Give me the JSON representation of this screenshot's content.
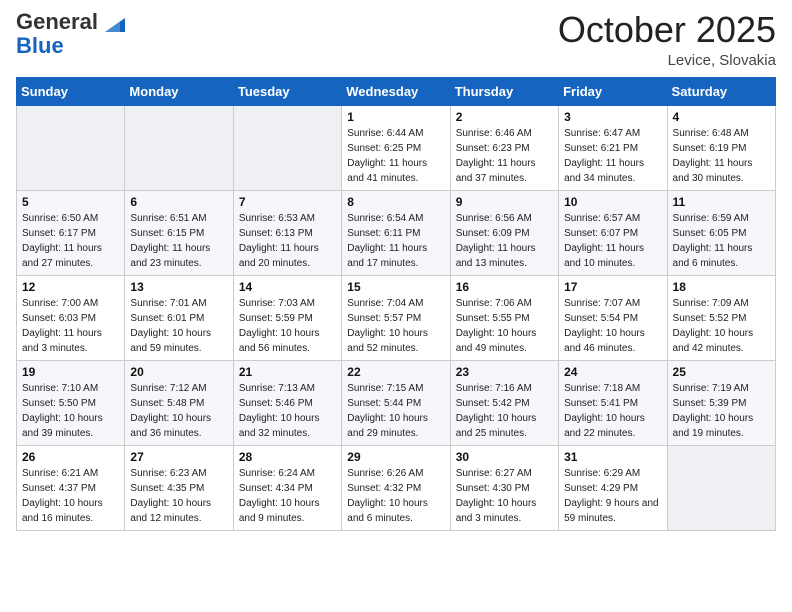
{
  "header": {
    "logo_general": "General",
    "logo_blue": "Blue",
    "month": "October 2025",
    "location": "Levice, Slovakia"
  },
  "weekdays": [
    "Sunday",
    "Monday",
    "Tuesday",
    "Wednesday",
    "Thursday",
    "Friday",
    "Saturday"
  ],
  "rows": [
    [
      {
        "day": "",
        "sunrise": "",
        "sunset": "",
        "daylight": "",
        "empty": true
      },
      {
        "day": "",
        "sunrise": "",
        "sunset": "",
        "daylight": "",
        "empty": true
      },
      {
        "day": "",
        "sunrise": "",
        "sunset": "",
        "daylight": "",
        "empty": true
      },
      {
        "day": "1",
        "sunrise": "Sunrise: 6:44 AM",
        "sunset": "Sunset: 6:25 PM",
        "daylight": "Daylight: 11 hours and 41 minutes."
      },
      {
        "day": "2",
        "sunrise": "Sunrise: 6:46 AM",
        "sunset": "Sunset: 6:23 PM",
        "daylight": "Daylight: 11 hours and 37 minutes."
      },
      {
        "day": "3",
        "sunrise": "Sunrise: 6:47 AM",
        "sunset": "Sunset: 6:21 PM",
        "daylight": "Daylight: 11 hours and 34 minutes."
      },
      {
        "day": "4",
        "sunrise": "Sunrise: 6:48 AM",
        "sunset": "Sunset: 6:19 PM",
        "daylight": "Daylight: 11 hours and 30 minutes."
      }
    ],
    [
      {
        "day": "5",
        "sunrise": "Sunrise: 6:50 AM",
        "sunset": "Sunset: 6:17 PM",
        "daylight": "Daylight: 11 hours and 27 minutes."
      },
      {
        "day": "6",
        "sunrise": "Sunrise: 6:51 AM",
        "sunset": "Sunset: 6:15 PM",
        "daylight": "Daylight: 11 hours and 23 minutes."
      },
      {
        "day": "7",
        "sunrise": "Sunrise: 6:53 AM",
        "sunset": "Sunset: 6:13 PM",
        "daylight": "Daylight: 11 hours and 20 minutes."
      },
      {
        "day": "8",
        "sunrise": "Sunrise: 6:54 AM",
        "sunset": "Sunset: 6:11 PM",
        "daylight": "Daylight: 11 hours and 17 minutes."
      },
      {
        "day": "9",
        "sunrise": "Sunrise: 6:56 AM",
        "sunset": "Sunset: 6:09 PM",
        "daylight": "Daylight: 11 hours and 13 minutes."
      },
      {
        "day": "10",
        "sunrise": "Sunrise: 6:57 AM",
        "sunset": "Sunset: 6:07 PM",
        "daylight": "Daylight: 11 hours and 10 minutes."
      },
      {
        "day": "11",
        "sunrise": "Sunrise: 6:59 AM",
        "sunset": "Sunset: 6:05 PM",
        "daylight": "Daylight: 11 hours and 6 minutes."
      }
    ],
    [
      {
        "day": "12",
        "sunrise": "Sunrise: 7:00 AM",
        "sunset": "Sunset: 6:03 PM",
        "daylight": "Daylight: 11 hours and 3 minutes."
      },
      {
        "day": "13",
        "sunrise": "Sunrise: 7:01 AM",
        "sunset": "Sunset: 6:01 PM",
        "daylight": "Daylight: 10 hours and 59 minutes."
      },
      {
        "day": "14",
        "sunrise": "Sunrise: 7:03 AM",
        "sunset": "Sunset: 5:59 PM",
        "daylight": "Daylight: 10 hours and 56 minutes."
      },
      {
        "day": "15",
        "sunrise": "Sunrise: 7:04 AM",
        "sunset": "Sunset: 5:57 PM",
        "daylight": "Daylight: 10 hours and 52 minutes."
      },
      {
        "day": "16",
        "sunrise": "Sunrise: 7:06 AM",
        "sunset": "Sunset: 5:55 PM",
        "daylight": "Daylight: 10 hours and 49 minutes."
      },
      {
        "day": "17",
        "sunrise": "Sunrise: 7:07 AM",
        "sunset": "Sunset: 5:54 PM",
        "daylight": "Daylight: 10 hours and 46 minutes."
      },
      {
        "day": "18",
        "sunrise": "Sunrise: 7:09 AM",
        "sunset": "Sunset: 5:52 PM",
        "daylight": "Daylight: 10 hours and 42 minutes."
      }
    ],
    [
      {
        "day": "19",
        "sunrise": "Sunrise: 7:10 AM",
        "sunset": "Sunset: 5:50 PM",
        "daylight": "Daylight: 10 hours and 39 minutes."
      },
      {
        "day": "20",
        "sunrise": "Sunrise: 7:12 AM",
        "sunset": "Sunset: 5:48 PM",
        "daylight": "Daylight: 10 hours and 36 minutes."
      },
      {
        "day": "21",
        "sunrise": "Sunrise: 7:13 AM",
        "sunset": "Sunset: 5:46 PM",
        "daylight": "Daylight: 10 hours and 32 minutes."
      },
      {
        "day": "22",
        "sunrise": "Sunrise: 7:15 AM",
        "sunset": "Sunset: 5:44 PM",
        "daylight": "Daylight: 10 hours and 29 minutes."
      },
      {
        "day": "23",
        "sunrise": "Sunrise: 7:16 AM",
        "sunset": "Sunset: 5:42 PM",
        "daylight": "Daylight: 10 hours and 25 minutes."
      },
      {
        "day": "24",
        "sunrise": "Sunrise: 7:18 AM",
        "sunset": "Sunset: 5:41 PM",
        "daylight": "Daylight: 10 hours and 22 minutes."
      },
      {
        "day": "25",
        "sunrise": "Sunrise: 7:19 AM",
        "sunset": "Sunset: 5:39 PM",
        "daylight": "Daylight: 10 hours and 19 minutes."
      }
    ],
    [
      {
        "day": "26",
        "sunrise": "Sunrise: 6:21 AM",
        "sunset": "Sunset: 4:37 PM",
        "daylight": "Daylight: 10 hours and 16 minutes."
      },
      {
        "day": "27",
        "sunrise": "Sunrise: 6:23 AM",
        "sunset": "Sunset: 4:35 PM",
        "daylight": "Daylight: 10 hours and 12 minutes."
      },
      {
        "day": "28",
        "sunrise": "Sunrise: 6:24 AM",
        "sunset": "Sunset: 4:34 PM",
        "daylight": "Daylight: 10 hours and 9 minutes."
      },
      {
        "day": "29",
        "sunrise": "Sunrise: 6:26 AM",
        "sunset": "Sunset: 4:32 PM",
        "daylight": "Daylight: 10 hours and 6 minutes."
      },
      {
        "day": "30",
        "sunrise": "Sunrise: 6:27 AM",
        "sunset": "Sunset: 4:30 PM",
        "daylight": "Daylight: 10 hours and 3 minutes."
      },
      {
        "day": "31",
        "sunrise": "Sunrise: 6:29 AM",
        "sunset": "Sunset: 4:29 PM",
        "daylight": "Daylight: 9 hours and 59 minutes."
      },
      {
        "day": "",
        "sunrise": "",
        "sunset": "",
        "daylight": "",
        "empty": true
      }
    ]
  ]
}
